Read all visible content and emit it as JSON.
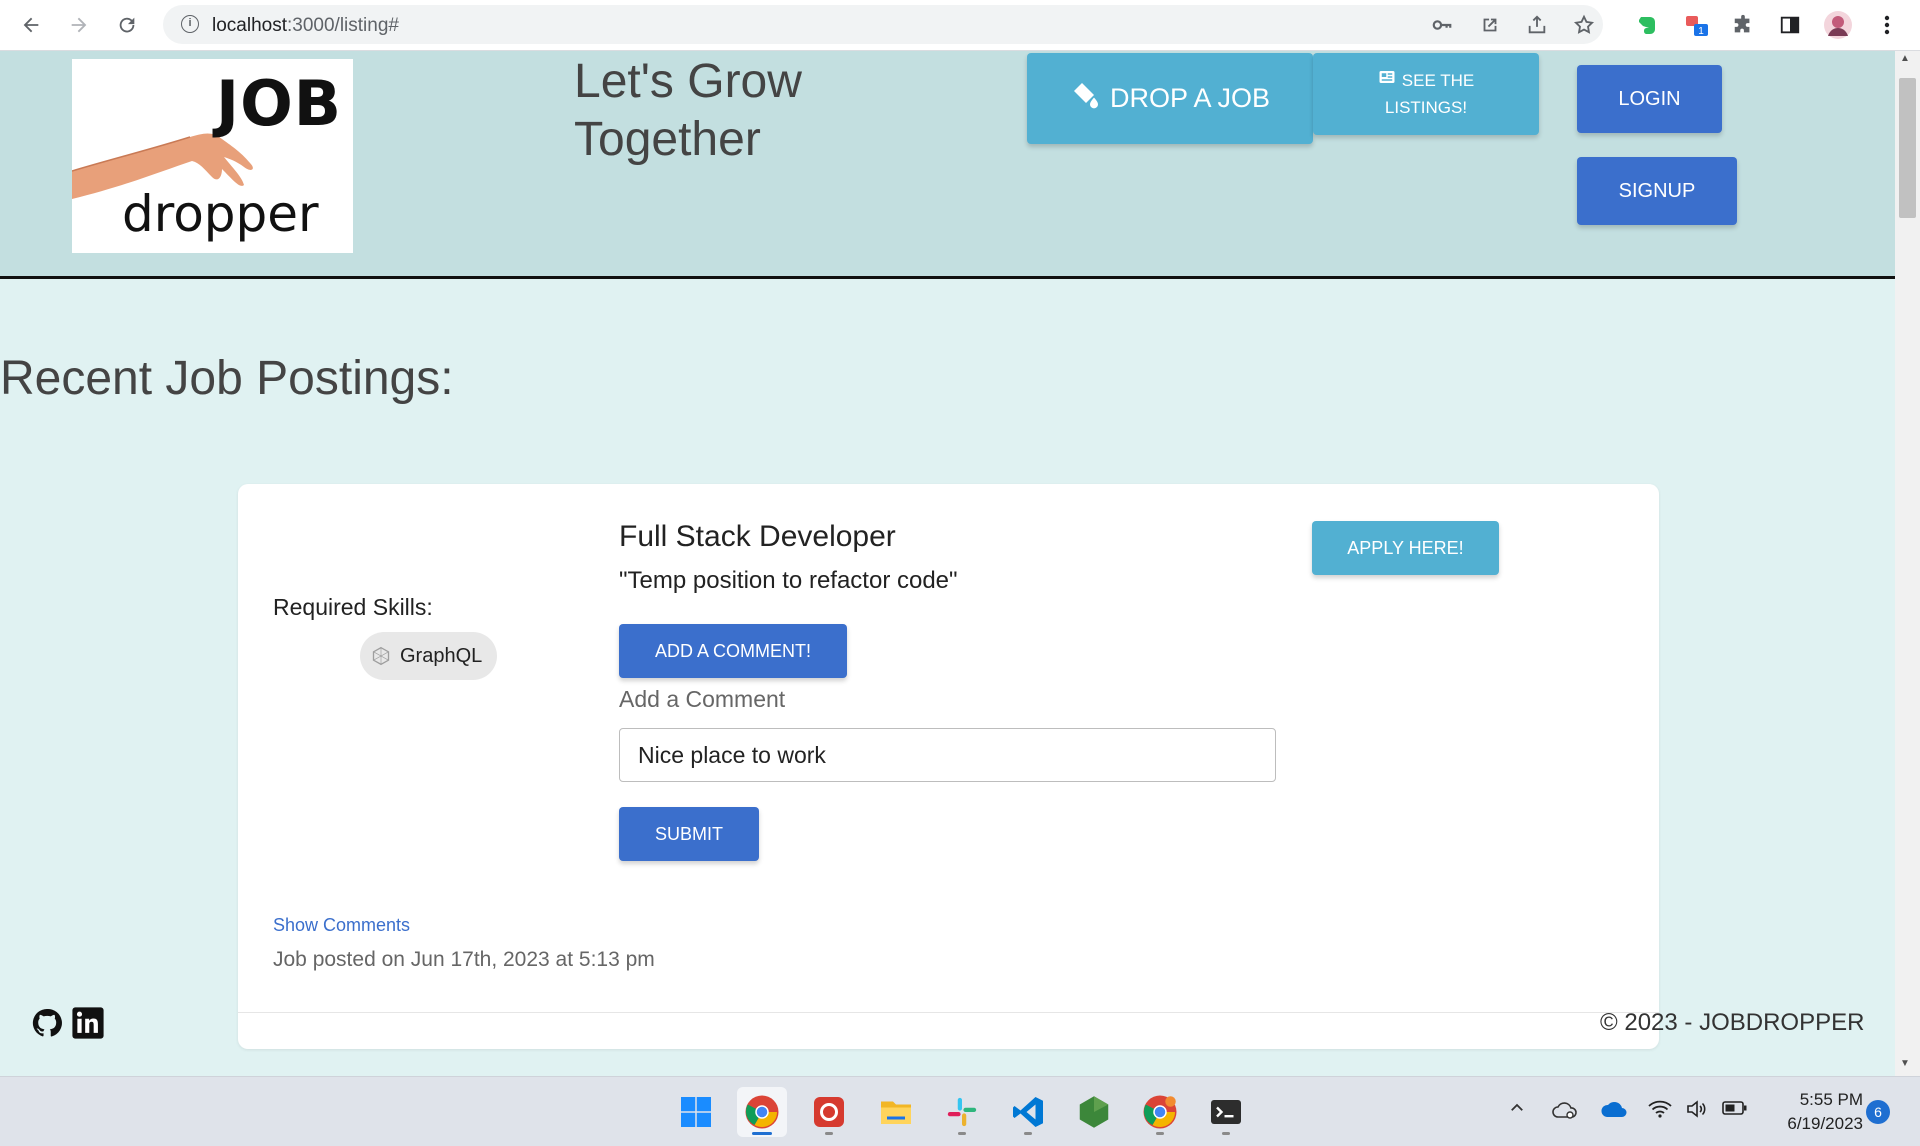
{
  "browser": {
    "url_host": "localhost",
    "url_path": ":3000/listing#",
    "profile_badge": "1"
  },
  "header": {
    "logo_top": "JOB",
    "logo_bottom": "dropper",
    "tagline_line1": "Let's Grow",
    "tagline_line2": "Together",
    "drop_job_label": "DROP A JOB",
    "see_listings_line1": "SEE THE",
    "see_listings_line2": "LISTINGS!",
    "login_label": "LOGIN",
    "signup_label": "SIGNUP"
  },
  "main": {
    "section_title": "Recent Job Postings:"
  },
  "listing": {
    "skills_label": "Required Skills:",
    "skills": [
      "GraphQL"
    ],
    "title": "Full Stack Developer",
    "description": "\"Temp position to refactor code\"",
    "apply_label": "APPLY HERE!",
    "add_comment_label": "ADD A COMMENT!",
    "comment_field_label": "Add a Comment",
    "comment_value": "Nice place to work",
    "submit_label": "SUBMIT",
    "show_comments_label": "Show Comments",
    "posted_text": "Job posted on Jun 17th, 2023 at 5:13 pm"
  },
  "footer": {
    "copyright": "© 2023 - JOBDROPPER",
    "social": [
      "github-icon",
      "linkedin-icon"
    ]
  },
  "taskbar": {
    "time": "5:55 PM",
    "date": "6/19/2023",
    "notification_count": "6",
    "apps": [
      "windows-start",
      "chrome",
      "app-red",
      "file-explorer",
      "slack",
      "vscode",
      "nodejs",
      "chrome-alt",
      "terminal"
    ]
  },
  "colors": {
    "header_bg": "#c3dfe0",
    "page_bg": "#e0f2f2",
    "primary": "#3b6fcc",
    "accent": "#52b0d2"
  }
}
